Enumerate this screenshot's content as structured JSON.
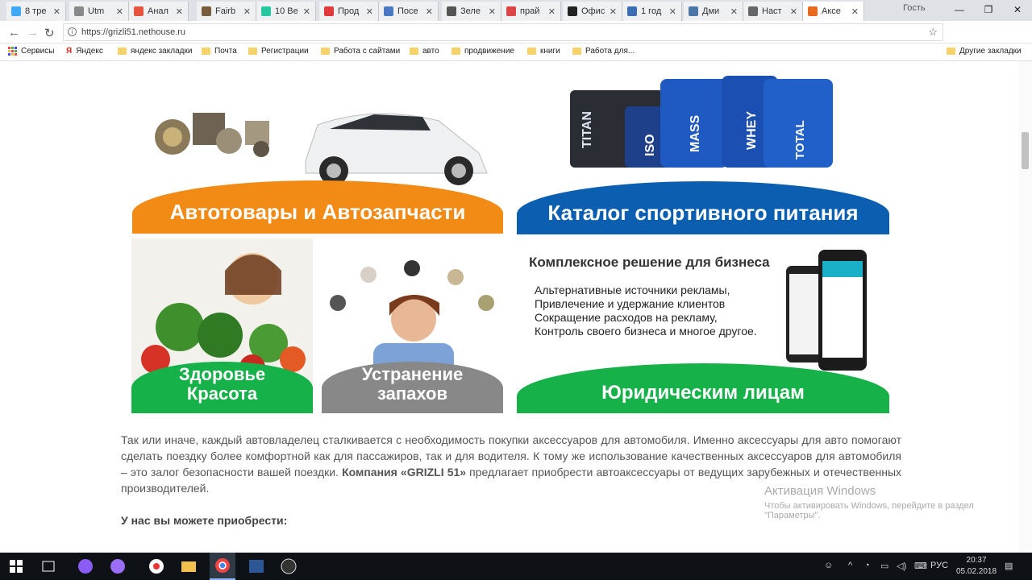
{
  "tabs": [
    {
      "label": "8 тре",
      "color": "#3fa9f5"
    },
    {
      "label": "Utm",
      "color": "#888"
    },
    {
      "label": "Анал",
      "color": "#e8553e"
    },
    {
      "label": "Fairb",
      "color": "#7a5c3e"
    },
    {
      "label": "10 Be",
      "color": "#27c7a0"
    },
    {
      "label": "Прод",
      "color": "#e03a3a"
    },
    {
      "label": "Посе",
      "color": "#4a78c2"
    },
    {
      "label": "Зеле",
      "color": "#555"
    },
    {
      "label": "прай",
      "color": "#d44"
    },
    {
      "label": "Офис",
      "color": "#222"
    },
    {
      "label": "1 год",
      "color": "#3a6fb5"
    },
    {
      "label": "Дми",
      "color": "#4a76a8"
    },
    {
      "label": "Наст",
      "color": "#666"
    },
    {
      "label": "Аксе",
      "color": "#e86a1e"
    }
  ],
  "window": {
    "guest": "Гость",
    "min": "—",
    "max": "❐",
    "close": "✕"
  },
  "address": {
    "url": "https://grizli51.nethouse.ru",
    "back": "←",
    "forward": "→",
    "reload": "↻",
    "star": "☆",
    "info": "i"
  },
  "bookmarks": {
    "apps": "Сервисы",
    "items": [
      "Яндекс",
      "яндекс закладки",
      "Почта",
      "Регистрации",
      "Работа с сайтами",
      "авто",
      "продвижение",
      "книги",
      "Работа для..."
    ],
    "other": "Другие закладки"
  },
  "banners": {
    "auto": "Автотовары и Автозапчасти",
    "sport": "Каталог спортивного питания",
    "health_1": "Здоровье",
    "health_2": "Красота",
    "odor_1": "Устранение",
    "odor_2": "запахов",
    "business_title": "Комплексное решение для бизнеса",
    "business_lines": [
      "Альтернативные источники рекламы,",
      "Привлечение и удержание клиентов",
      "Сокращение расходов на рекламу,",
      "Контроль своего бизнеса и многое другое."
    ],
    "legal": "Юридическим лицам",
    "jars": [
      "TITAN",
      "ISO",
      "MASS",
      "WHEY",
      "TOTAL"
    ]
  },
  "text": {
    "para_1": "Так или иначе, каждый автовладелец сталкивается с необходимость покупки аксессуаров для автомобиля. Именно аксессуары для авто помогают сделать поездку более комфортной как для пассажиров, так и для водителя. К тому же использование качественных аксессуаров для автомобиля – это залог безопасности вашей поездки.",
    "company": "Компания «GRIZLI 51»",
    "para_2": "предлагает приобрести автоаксессуары от ведущих зарубежных и отечественных производителей.",
    "subhead": "У нас вы можете приобрести:"
  },
  "activation": {
    "title": "Активация Windows",
    "line1": "Чтобы активировать Windows, перейдите в раздел",
    "line2": "\"Параметры\"."
  },
  "tray": {
    "lang": "РУС",
    "time": "20:37",
    "date": "05.02.2018"
  }
}
